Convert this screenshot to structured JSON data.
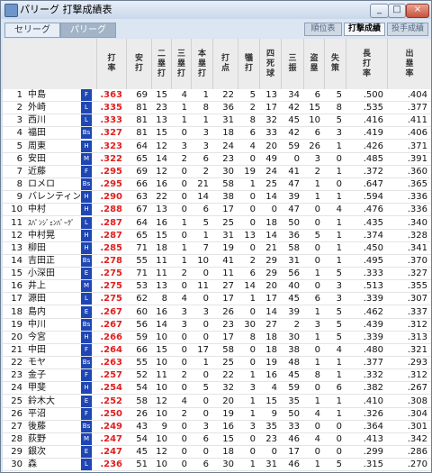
{
  "window": {
    "title": "パリーグ 打撃成績表",
    "btn_min": "_",
    "btn_max": "□",
    "btn_close": "×"
  },
  "league_tabs": [
    {
      "label": "セリーグ",
      "active": false
    },
    {
      "label": "パリーグ",
      "active": true
    }
  ],
  "view_tabs": [
    {
      "label": "順位表",
      "active": false
    },
    {
      "label": "打撃成績",
      "active": true
    },
    {
      "label": "投手成績",
      "active": false
    }
  ],
  "headers": [
    {
      "lines": [
        "打",
        "率"
      ]
    },
    {
      "lines": [
        "安",
        "打"
      ]
    },
    {
      "lines": [
        "二",
        "塁",
        "打"
      ]
    },
    {
      "lines": [
        "三",
        "塁",
        "打"
      ]
    },
    {
      "lines": [
        "本",
        "塁",
        "打"
      ]
    },
    {
      "lines": [
        "打",
        "点"
      ]
    },
    {
      "lines": [
        "犠",
        "打"
      ]
    },
    {
      "lines": [
        "四",
        "死",
        "球"
      ]
    },
    {
      "lines": [
        "三",
        "振"
      ]
    },
    {
      "lines": [
        "盗",
        "塁"
      ]
    },
    {
      "lines": [
        "失",
        "策"
      ]
    },
    {
      "lines": [
        "長",
        "打",
        "率"
      ]
    },
    {
      "lines": [
        "出",
        "塁",
        "率"
      ]
    }
  ],
  "rows": [
    {
      "rank": "1",
      "name": "中島",
      "team": "F",
      "avg": ".363",
      "h": "69",
      "d2": "15",
      "d3": "4",
      "hr": "1",
      "rbi": "22",
      "sh": "5",
      "bb": "13",
      "so": "34",
      "sb": "6",
      "e": "5",
      "slg": ".500",
      "obp": ".404"
    },
    {
      "rank": "2",
      "name": "外崎",
      "team": "L",
      "avg": ".335",
      "h": "81",
      "d2": "23",
      "d3": "1",
      "hr": "8",
      "rbi": "36",
      "sh": "2",
      "bb": "17",
      "so": "42",
      "sb": "15",
      "e": "8",
      "slg": ".535",
      "obp": ".377"
    },
    {
      "rank": "3",
      "name": "西川",
      "team": "L",
      "avg": ".333",
      "h": "81",
      "d2": "13",
      "d3": "1",
      "hr": "1",
      "rbi": "31",
      "sh": "8",
      "bb": "32",
      "so": "45",
      "sb": "10",
      "e": "5",
      "slg": ".416",
      "obp": ".411"
    },
    {
      "rank": "4",
      "name": "福田",
      "team": "Bs",
      "avg": ".327",
      "h": "81",
      "d2": "15",
      "d3": "0",
      "hr": "3",
      "rbi": "18",
      "sh": "6",
      "bb": "33",
      "so": "42",
      "sb": "6",
      "e": "3",
      "slg": ".419",
      "obp": ".406"
    },
    {
      "rank": "5",
      "name": "周東",
      "team": "H",
      "avg": ".323",
      "h": "64",
      "d2": "12",
      "d3": "3",
      "hr": "3",
      "rbi": "24",
      "sh": "4",
      "bb": "20",
      "so": "59",
      "sb": "26",
      "e": "1",
      "slg": ".426",
      "obp": ".371"
    },
    {
      "rank": "6",
      "name": "安田",
      "team": "M",
      "avg": ".322",
      "h": "65",
      "d2": "14",
      "d3": "2",
      "hr": "6",
      "rbi": "23",
      "sh": "0",
      "bb": "49",
      "so": "0",
      "sb": "3",
      "e": "0",
      "slg": ".485",
      "obp": ".391"
    },
    {
      "rank": "7",
      "name": "近藤",
      "team": "F",
      "avg": ".295",
      "h": "69",
      "d2": "12",
      "d3": "0",
      "hr": "2",
      "rbi": "30",
      "sh": "19",
      "bb": "24",
      "so": "41",
      "sb": "2",
      "e": "1",
      "slg": ".372",
      "obp": ".360"
    },
    {
      "rank": "8",
      "name": "ロメロ",
      "team": "Bs",
      "avg": ".295",
      "h": "66",
      "d2": "16",
      "d3": "0",
      "hr": "21",
      "rbi": "58",
      "sh": "1",
      "bb": "25",
      "so": "47",
      "sb": "1",
      "e": "0",
      "slg": ".647",
      "obp": ".365"
    },
    {
      "rank": "9",
      "name": "バレンティン",
      "team": "H",
      "avg": ".290",
      "h": "63",
      "d2": "22",
      "d3": "0",
      "hr": "14",
      "rbi": "38",
      "sh": "0",
      "bb": "14",
      "so": "39",
      "sb": "1",
      "e": "1",
      "slg": ".594",
      "obp": ".336"
    },
    {
      "rank": "10",
      "name": "中村",
      "team": "H",
      "avg": ".288",
      "h": "67",
      "d2": "13",
      "d3": "0",
      "hr": "6",
      "rbi": "17",
      "sh": "0",
      "bb": "0",
      "so": "47",
      "sb": "0",
      "e": "4",
      "slg": ".476",
      "obp": ".336"
    },
    {
      "rank": "11",
      "name": "ｽﾊﾟﾝｼﾞｪﾝﾊﾞｰｸﾞ",
      "team": "L",
      "avg": ".287",
      "h": "64",
      "d2": "16",
      "d3": "1",
      "hr": "5",
      "rbi": "25",
      "sh": "0",
      "bb": "18",
      "so": "50",
      "sb": "0",
      "e": "1",
      "slg": ".435",
      "obp": ".340"
    },
    {
      "rank": "12",
      "name": "中村晃",
      "team": "H",
      "avg": ".287",
      "h": "65",
      "d2": "15",
      "d3": "0",
      "hr": "1",
      "rbi": "31",
      "sh": "13",
      "bb": "14",
      "so": "36",
      "sb": "5",
      "e": "1",
      "slg": ".374",
      "obp": ".328"
    },
    {
      "rank": "13",
      "name": "柳田",
      "team": "H",
      "avg": ".285",
      "h": "71",
      "d2": "18",
      "d3": "1",
      "hr": "7",
      "rbi": "19",
      "sh": "0",
      "bb": "21",
      "so": "58",
      "sb": "0",
      "e": "1",
      "slg": ".450",
      "obp": ".341"
    },
    {
      "rank": "14",
      "name": "吉田正",
      "team": "Bs",
      "avg": ".278",
      "h": "55",
      "d2": "11",
      "d3": "1",
      "hr": "10",
      "rbi": "41",
      "sh": "2",
      "bb": "29",
      "so": "31",
      "sb": "0",
      "e": "1",
      "slg": ".495",
      "obp": ".370"
    },
    {
      "rank": "15",
      "name": "小深田",
      "team": "E",
      "avg": ".275",
      "h": "71",
      "d2": "11",
      "d3": "2",
      "hr": "0",
      "rbi": "11",
      "sh": "6",
      "bb": "29",
      "so": "56",
      "sb": "1",
      "e": "5",
      "slg": ".333",
      "obp": ".327"
    },
    {
      "rank": "16",
      "name": "井上",
      "team": "M",
      "avg": ".275",
      "h": "53",
      "d2": "13",
      "d3": "0",
      "hr": "11",
      "rbi": "27",
      "sh": "14",
      "bb": "20",
      "so": "40",
      "sb": "0",
      "e": "3",
      "slg": ".513",
      "obp": ".355"
    },
    {
      "rank": "17",
      "name": "源田",
      "team": "L",
      "avg": ".275",
      "h": "62",
      "d2": "8",
      "d3": "4",
      "hr": "0",
      "rbi": "17",
      "sh": "1",
      "bb": "17",
      "so": "45",
      "sb": "6",
      "e": "3",
      "slg": ".339",
      "obp": ".307"
    },
    {
      "rank": "18",
      "name": "島内",
      "team": "E",
      "avg": ".267",
      "h": "60",
      "d2": "16",
      "d3": "3",
      "hr": "3",
      "rbi": "26",
      "sh": "0",
      "bb": "14",
      "so": "39",
      "sb": "1",
      "e": "5",
      "slg": ".462",
      "obp": ".337"
    },
    {
      "rank": "19",
      "name": "中川",
      "team": "Bs",
      "avg": ".267",
      "h": "56",
      "d2": "14",
      "d3": "3",
      "hr": "0",
      "rbi": "23",
      "sh": "30",
      "bb": "27",
      "so": "2",
      "sb": "3",
      "e": "5",
      "slg": ".439",
      "obp": ".312"
    },
    {
      "rank": "20",
      "name": "今宮",
      "team": "H",
      "avg": ".266",
      "h": "59",
      "d2": "10",
      "d3": "0",
      "hr": "0",
      "rbi": "17",
      "sh": "8",
      "bb": "18",
      "so": "30",
      "sb": "1",
      "e": "5",
      "slg": ".339",
      "obp": ".313"
    },
    {
      "rank": "21",
      "name": "中田",
      "team": "F",
      "avg": ".264",
      "h": "66",
      "d2": "15",
      "d3": "0",
      "hr": "17",
      "rbi": "58",
      "sh": "0",
      "bb": "18",
      "so": "38",
      "sb": "0",
      "e": "4",
      "slg": ".480",
      "obp": ".321"
    },
    {
      "rank": "22",
      "name": "モヤ",
      "team": "Bs",
      "avg": ".263",
      "h": "55",
      "d2": "10",
      "d3": "0",
      "hr": "1",
      "rbi": "25",
      "sh": "0",
      "bb": "19",
      "so": "48",
      "sb": "1",
      "e": "1",
      "slg": ".377",
      "obp": ".293"
    },
    {
      "rank": "23",
      "name": "金子",
      "team": "F",
      "avg": ".257",
      "h": "52",
      "d2": "11",
      "d3": "2",
      "hr": "0",
      "rbi": "22",
      "sh": "1",
      "bb": "16",
      "so": "45",
      "sb": "8",
      "e": "1",
      "slg": ".332",
      "obp": ".312"
    },
    {
      "rank": "24",
      "name": "甲斐",
      "team": "H",
      "avg": ".254",
      "h": "54",
      "d2": "10",
      "d3": "0",
      "hr": "5",
      "rbi": "32",
      "sh": "3",
      "bb": "4",
      "so": "59",
      "sb": "0",
      "e": "6",
      "slg": ".382",
      "obp": ".267"
    },
    {
      "rank": "25",
      "name": "鈴木大",
      "team": "E",
      "avg": ".252",
      "h": "58",
      "d2": "12",
      "d3": "4",
      "hr": "0",
      "rbi": "20",
      "sh": "1",
      "bb": "15",
      "so": "35",
      "sb": "1",
      "e": "1",
      "slg": ".410",
      "obp": ".308"
    },
    {
      "rank": "26",
      "name": "平沼",
      "team": "F",
      "avg": ".250",
      "h": "26",
      "d2": "10",
      "d3": "2",
      "hr": "0",
      "rbi": "19",
      "sh": "1",
      "bb": "9",
      "so": "50",
      "sb": "4",
      "e": "1",
      "slg": ".326",
      "obp": ".304"
    },
    {
      "rank": "27",
      "name": "後藤",
      "team": "Bs",
      "avg": ".249",
      "h": "43",
      "d2": "9",
      "d3": "0",
      "hr": "3",
      "rbi": "16",
      "sh": "3",
      "bb": "35",
      "so": "33",
      "sb": "0",
      "e": "0",
      "slg": ".364",
      "obp": ".301"
    },
    {
      "rank": "28",
      "name": "荻野",
      "team": "M",
      "avg": ".247",
      "h": "54",
      "d2": "10",
      "d3": "0",
      "hr": "6",
      "rbi": "15",
      "sh": "0",
      "bb": "23",
      "so": "46",
      "sb": "4",
      "e": "0",
      "slg": ".413",
      "obp": ".342"
    },
    {
      "rank": "29",
      "name": "銀次",
      "team": "E",
      "avg": ".247",
      "h": "45",
      "d2": "12",
      "d3": "0",
      "hr": "0",
      "rbi": "18",
      "sh": "0",
      "bb": "0",
      "so": "17",
      "sb": "0",
      "e": "0",
      "slg": ".299",
      "obp": ".286"
    },
    {
      "rank": "30",
      "name": "森",
      "team": "L",
      "avg": ".236",
      "h": "51",
      "d2": "10",
      "d3": "0",
      "hr": "6",
      "rbi": "30",
      "sh": "1",
      "bb": "31",
      "so": "46",
      "sb": "1",
      "e": "5",
      "slg": ".315",
      "obp": ".270"
    }
  ]
}
